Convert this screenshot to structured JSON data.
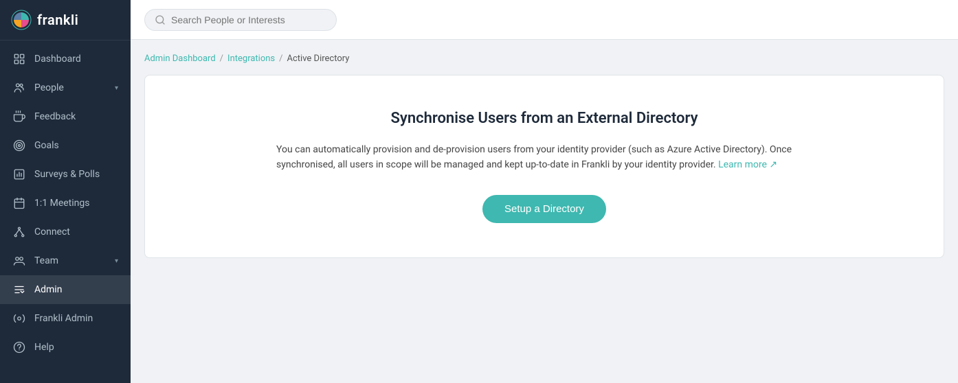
{
  "logo": {
    "text": "frankli"
  },
  "sidebar": {
    "items": [
      {
        "id": "dashboard",
        "label": "Dashboard",
        "icon": "dashboard"
      },
      {
        "id": "people",
        "label": "People",
        "icon": "people",
        "hasChevron": true
      },
      {
        "id": "feedback",
        "label": "Feedback",
        "icon": "feedback"
      },
      {
        "id": "goals",
        "label": "Goals",
        "icon": "goals"
      },
      {
        "id": "surveys",
        "label": "Surveys & Polls",
        "icon": "surveys"
      },
      {
        "id": "meetings",
        "label": "1:1 Meetings",
        "icon": "meetings"
      },
      {
        "id": "connect",
        "label": "Connect",
        "icon": "connect"
      },
      {
        "id": "team",
        "label": "Team",
        "icon": "team",
        "hasChevron": true
      },
      {
        "id": "admin",
        "label": "Admin",
        "icon": "admin",
        "active": true
      },
      {
        "id": "frankli-admin",
        "label": "Frankli Admin",
        "icon": "frankli-admin"
      },
      {
        "id": "help",
        "label": "Help",
        "icon": "help"
      }
    ]
  },
  "header": {
    "search_placeholder": "Search People or Interests"
  },
  "breadcrumb": {
    "items": [
      {
        "id": "admin-dashboard",
        "label": "Admin Dashboard",
        "link": true
      },
      {
        "id": "integrations",
        "label": "Integrations",
        "link": true
      },
      {
        "id": "active-directory",
        "label": "Active Directory",
        "link": false
      }
    ]
  },
  "main": {
    "card": {
      "title": "Synchronise Users from an External Directory",
      "description_part1": "You can automatically provision and de-provision users from your identity provider (such as Azure Active Directory). Once synchronised, all users in scope will be managed and kept up-to-date in Frankli by your identity provider.",
      "learn_more_label": "Learn more",
      "setup_button_label": "Setup a Directory"
    }
  }
}
